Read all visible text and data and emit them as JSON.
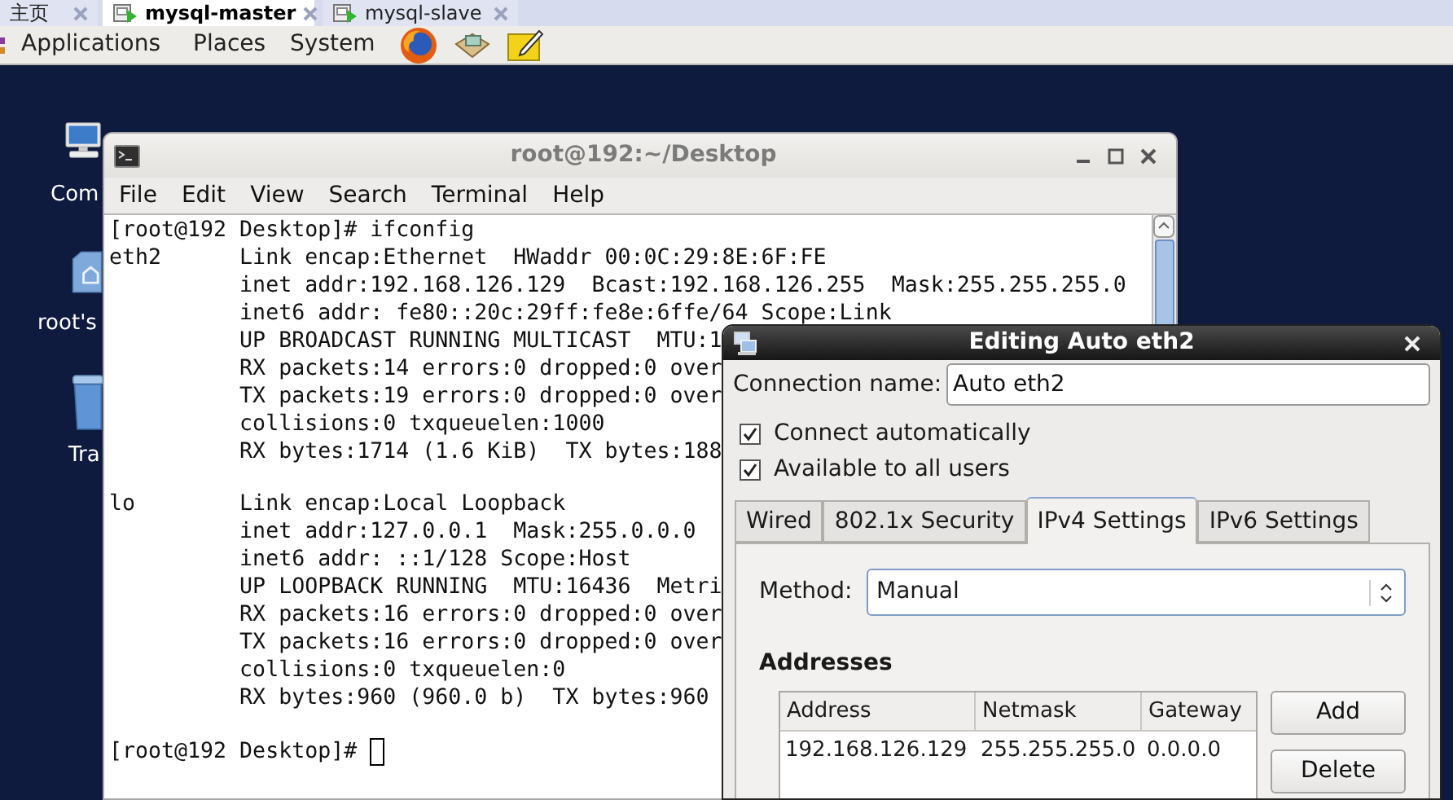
{
  "vm_tabs": [
    {
      "label": "主页",
      "selected": false
    },
    {
      "label": "mysql-master",
      "selected": true
    },
    {
      "label": "mysql-slave",
      "selected": false
    }
  ],
  "panel": {
    "menus": [
      "Applications",
      "Places",
      "System"
    ]
  },
  "desktop_icons": [
    {
      "label": "Com",
      "kind": "computer"
    },
    {
      "label": "root's",
      "kind": "home"
    },
    {
      "label": "Tra",
      "kind": "trash"
    }
  ],
  "terminal": {
    "title": "root@192:~/Desktop",
    "menu": [
      "File",
      "Edit",
      "View",
      "Search",
      "Terminal",
      "Help"
    ],
    "blocks": [
      [
        "[root@192 Desktop]# ifconfig",
        "eth2      Link encap:Ethernet  HWaddr 00:0C:29:8E:6F:FE",
        "          inet addr:192.168.126.129  Bcast:192.168.126.255  Mask:255.255.255.0",
        "          inet6 addr: fe80::20c:29ff:fe8e:6ffe/64 Scope:Link",
        "          UP BROADCAST RUNNING MULTICAST  MTU:1",
        "          RX packets:14 errors:0 dropped:0 over",
        "          TX packets:19 errors:0 dropped:0 over",
        "          collisions:0 txqueuelen:1000",
        "          RX bytes:1714 (1.6 KiB)  TX bytes:188"
      ],
      [
        "lo        Link encap:Local Loopback",
        "          inet addr:127.0.0.1  Mask:255.0.0.0",
        "          inet6 addr: ::1/128 Scope:Host",
        "          UP LOOPBACK RUNNING  MTU:16436  Metri",
        "          RX packets:16 errors:0 dropped:0 over",
        "          TX packets:16 errors:0 dropped:0 over",
        "          collisions:0 txqueuelen:0",
        "          RX bytes:960 (960.0 b)  TX bytes:960"
      ]
    ],
    "prompt": "[root@192 Desktop]#",
    "cursor": true
  },
  "dialog": {
    "title": "Editing Auto eth2",
    "connection_name": {
      "label": "Connection name:",
      "value": "Auto eth2"
    },
    "options": [
      {
        "label": "Connect automatically",
        "checked": true
      },
      {
        "label": "Available to all users",
        "checked": true
      }
    ],
    "tabs": [
      {
        "label": "Wired",
        "selected": false
      },
      {
        "label": "802.1x Security",
        "selected": false
      },
      {
        "label": "IPv4 Settings",
        "selected": true
      },
      {
        "label": "IPv6 Settings",
        "selected": false
      }
    ],
    "method": {
      "label": "Method:",
      "value": "Manual"
    },
    "addresses": {
      "title": "Addresses",
      "columns": [
        "Address",
        "Netmask",
        "Gateway"
      ],
      "rows": [
        [
          "192.168.126.129",
          "255.255.255.0",
          "0.0.0.0"
        ]
      ]
    },
    "buttons": [
      "Add",
      "Delete"
    ]
  }
}
